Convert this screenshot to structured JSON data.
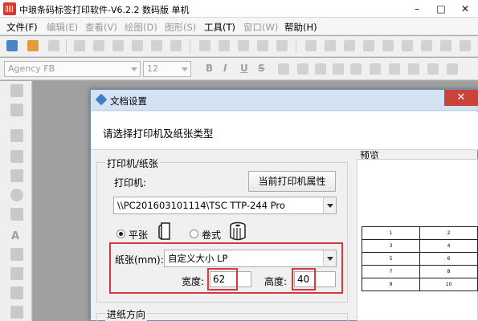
{
  "window": {
    "title": "中琅条码标签打印软件-V6.2.2 数码版 单机"
  },
  "menu": [
    {
      "label": "文件(F)",
      "enabled": true
    },
    {
      "label": "编辑(E)",
      "enabled": false
    },
    {
      "label": "查看(V)",
      "enabled": false
    },
    {
      "label": "绘图(D)",
      "enabled": false
    },
    {
      "label": "图形(S)",
      "enabled": false
    },
    {
      "label": "工具(T)",
      "enabled": true
    },
    {
      "label": "窗口(W)",
      "enabled": false
    },
    {
      "label": "帮助(H)",
      "enabled": true
    }
  ],
  "format_toolbar": {
    "font": "Agency FB",
    "size": "12",
    "bold": "B",
    "italic": "I",
    "underline": "U",
    "strike": "S"
  },
  "dialog": {
    "title": "文档设置",
    "close": "✕",
    "prompt": "请选择打印机及纸张类型",
    "printer_group": {
      "title": "打印机/纸张",
      "printer_label": "打印机:",
      "properties_button": "当前打印机属性",
      "printer_value": "\\\\PC201603101114\\TSC TTP-244 Pro",
      "paper_type_flat": "平张",
      "paper_type_roll": "卷式",
      "selected_type": "平张",
      "paper_label": "纸张(mm):",
      "paper_value": "自定义大小 LP",
      "width_label": "宽度:",
      "width_value": "62",
      "height_label": "高度:",
      "height_value": "40"
    },
    "feed_group": {
      "title": "进纸方向"
    },
    "preview": {
      "title": "预览",
      "cells": [
        [
          "1",
          "2"
        ],
        [
          "3",
          "4"
        ],
        [
          "5",
          "6"
        ],
        [
          "7",
          "8"
        ],
        [
          "9",
          "10"
        ]
      ]
    }
  },
  "colors": {
    "highlight": "#d9363e",
    "dialog_title_bg": "#d4e3f4",
    "close_button": "#c9433a"
  }
}
